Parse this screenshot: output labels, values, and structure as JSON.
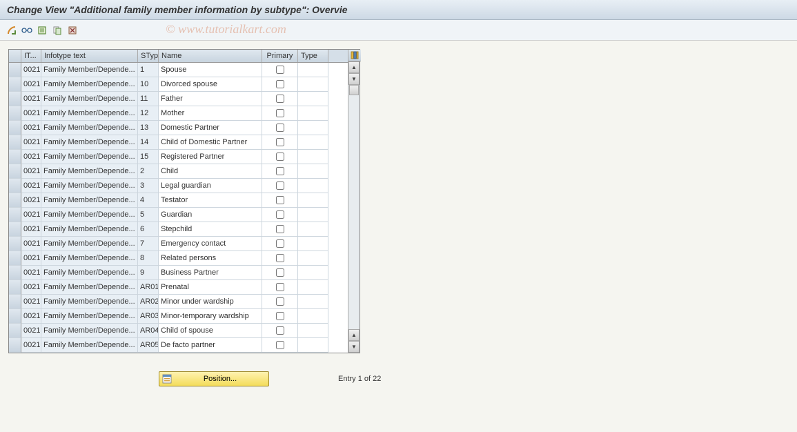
{
  "title": "Change View \"Additional family member information by subtype\": Overvie",
  "watermark": "© www.tutorialkart.com",
  "columns": {
    "sel": "",
    "it": "IT...",
    "text": "Infotype text",
    "styp": "STyp",
    "name": "Name",
    "primary": "Primary",
    "type": "Type"
  },
  "rows": [
    {
      "it": "0021",
      "text": "Family Member/Depende...",
      "styp": "1",
      "name": "Spouse",
      "primary": false,
      "type": ""
    },
    {
      "it": "0021",
      "text": "Family Member/Depende...",
      "styp": "10",
      "name": "Divorced spouse",
      "primary": false,
      "type": ""
    },
    {
      "it": "0021",
      "text": "Family Member/Depende...",
      "styp": "11",
      "name": "Father",
      "primary": false,
      "type": ""
    },
    {
      "it": "0021",
      "text": "Family Member/Depende...",
      "styp": "12",
      "name": "Mother",
      "primary": false,
      "type": ""
    },
    {
      "it": "0021",
      "text": "Family Member/Depende...",
      "styp": "13",
      "name": "Domestic Partner",
      "primary": false,
      "type": ""
    },
    {
      "it": "0021",
      "text": "Family Member/Depende...",
      "styp": "14",
      "name": "Child of Domestic Partner",
      "primary": false,
      "type": ""
    },
    {
      "it": "0021",
      "text": "Family Member/Depende...",
      "styp": "15",
      "name": "Registered Partner",
      "primary": false,
      "type": ""
    },
    {
      "it": "0021",
      "text": "Family Member/Depende...",
      "styp": "2",
      "name": "Child",
      "primary": false,
      "type": ""
    },
    {
      "it": "0021",
      "text": "Family Member/Depende...",
      "styp": "3",
      "name": "Legal guardian",
      "primary": false,
      "type": ""
    },
    {
      "it": "0021",
      "text": "Family Member/Depende...",
      "styp": "4",
      "name": "Testator",
      "primary": false,
      "type": ""
    },
    {
      "it": "0021",
      "text": "Family Member/Depende...",
      "styp": "5",
      "name": "Guardian",
      "primary": false,
      "type": ""
    },
    {
      "it": "0021",
      "text": "Family Member/Depende...",
      "styp": "6",
      "name": "Stepchild",
      "primary": false,
      "type": ""
    },
    {
      "it": "0021",
      "text": "Family Member/Depende...",
      "styp": "7",
      "name": "Emergency contact",
      "primary": false,
      "type": ""
    },
    {
      "it": "0021",
      "text": "Family Member/Depende...",
      "styp": "8",
      "name": "Related persons",
      "primary": false,
      "type": ""
    },
    {
      "it": "0021",
      "text": "Family Member/Depende...",
      "styp": "9",
      "name": "Business Partner",
      "primary": false,
      "type": ""
    },
    {
      "it": "0021",
      "text": "Family Member/Depende...",
      "styp": "AR01",
      "name": "Prenatal",
      "primary": false,
      "type": ""
    },
    {
      "it": "0021",
      "text": "Family Member/Depende...",
      "styp": "AR02",
      "name": "Minor under wardship",
      "primary": false,
      "type": ""
    },
    {
      "it": "0021",
      "text": "Family Member/Depende...",
      "styp": "AR03",
      "name": "Minor-temporary wardship",
      "primary": false,
      "type": ""
    },
    {
      "it": "0021",
      "text": "Family Member/Depende...",
      "styp": "AR04",
      "name": "Child of spouse",
      "primary": false,
      "type": ""
    },
    {
      "it": "0021",
      "text": "Family Member/Depende...",
      "styp": "AR05",
      "name": "De facto partner",
      "primary": false,
      "type": ""
    }
  ],
  "footer": {
    "position_label": "Position...",
    "entry_text": "Entry 1 of 22"
  }
}
